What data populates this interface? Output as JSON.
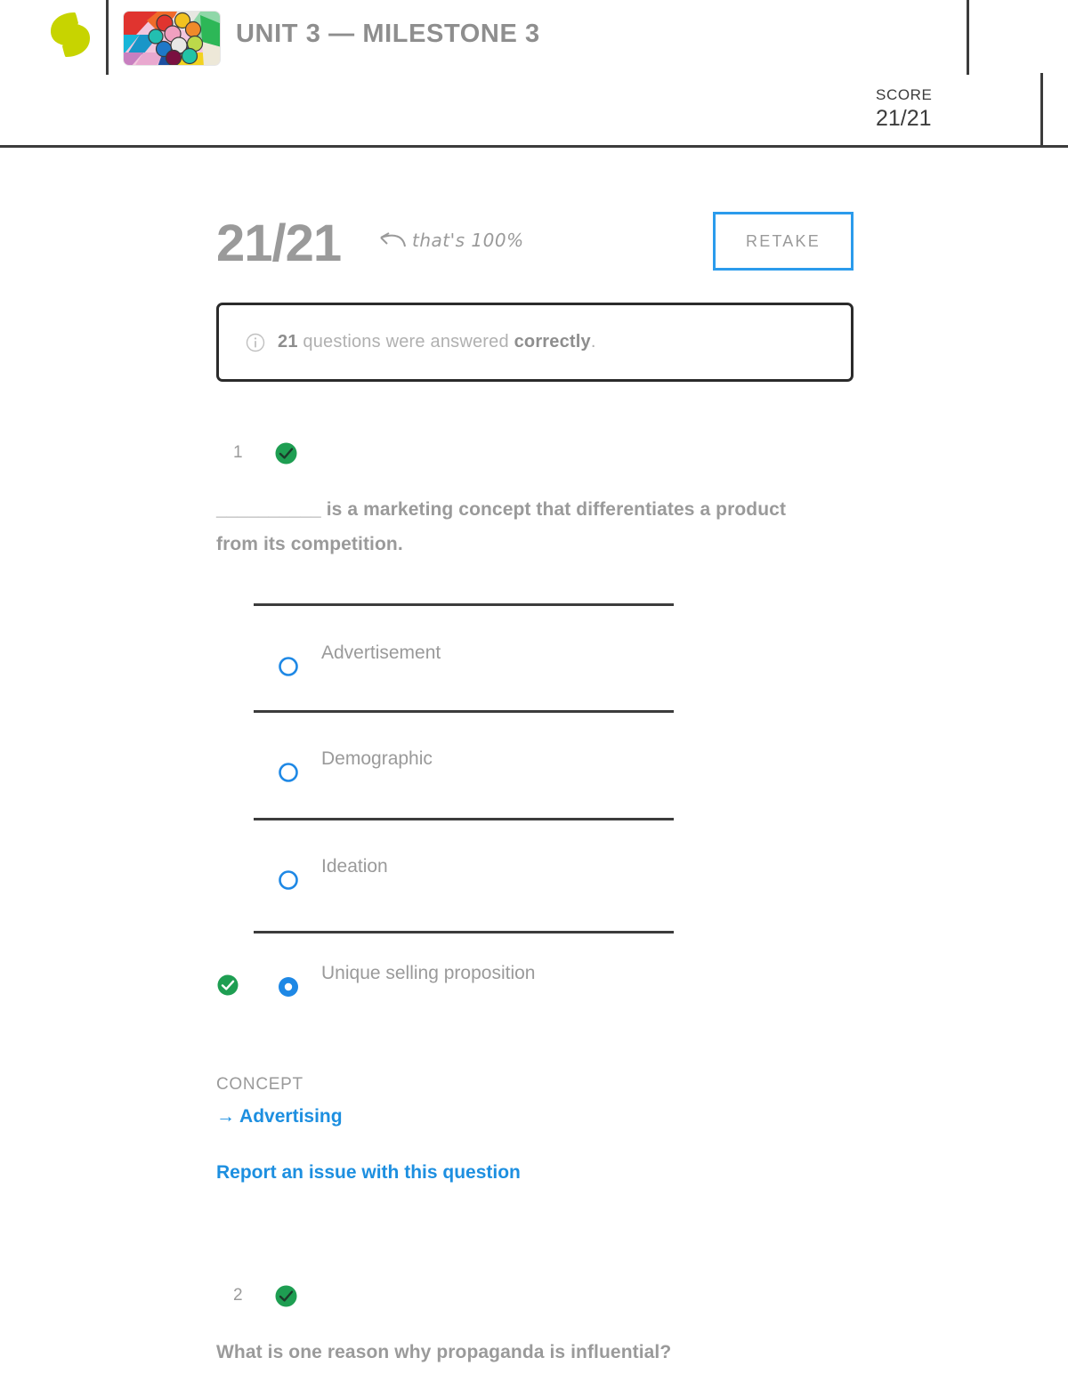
{
  "header": {
    "logo_icon": "sophia-logo-icon",
    "thumbnail_icon": "course-thumbnail-image",
    "title": "UNIT 3 — MILESTONE 3",
    "score_label": "SCORE",
    "score_value": "21/21"
  },
  "summary": {
    "score_big": "21/21",
    "hand_note": "that's 100%",
    "hand_arrow_icon": "curved-left-arrow-icon",
    "retake_label": "RETAKE",
    "info_icon": "info-circle-icon",
    "info_count": "21",
    "info_middle": " questions were answered ",
    "info_bold": "correctly",
    "info_end": "."
  },
  "questions": [
    {
      "number": "1",
      "status_icon": "green-check-circle-icon",
      "text": "__________ is a marketing concept that differentiates a product from its competition.",
      "options": [
        {
          "label": "Advertisement",
          "selected": false,
          "correct": false
        },
        {
          "label": "Demographic",
          "selected": false,
          "correct": false
        },
        {
          "label": "Ideation",
          "selected": false,
          "correct": false
        },
        {
          "label": "Unique selling proposition",
          "selected": true,
          "correct": true
        }
      ],
      "concept_label": "CONCEPT",
      "concept_link": "→ Advertising",
      "report_link": "Report an issue with this question"
    },
    {
      "number": "2",
      "status_icon": "green-check-circle-icon",
      "text": "What is one reason why propaganda is influential?"
    }
  ],
  "colors": {
    "logo_green": "#c7d400",
    "accent_blue": "#1d8fe0",
    "retake_border": "#2b9bec",
    "correct_green": "#1e9e52",
    "radio_blue": "#1e88e5",
    "text_gray": "#9a9a9a",
    "rule_dark": "#3c3c3c"
  }
}
